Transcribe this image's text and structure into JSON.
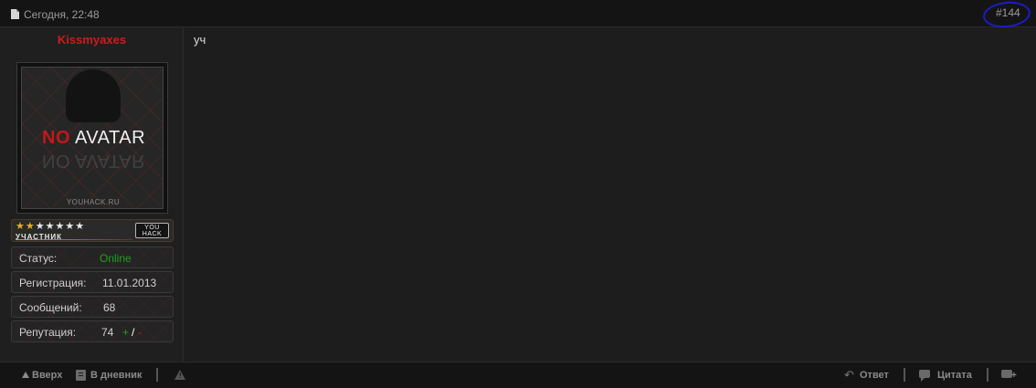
{
  "header": {
    "date": "Сегодня, 22:48",
    "post_number": "#144"
  },
  "user": {
    "name": "Kissmyaxes",
    "avatar": {
      "text_no": "NO",
      "text_avatar": "AVATAR",
      "site": "YOUHACK.RU"
    },
    "rank": {
      "title": "УЧАСТНИК",
      "stars_filled": 2,
      "stars_total": 7,
      "badge_line1": "YOU",
      "badge_line2": "HACK"
    },
    "info": {
      "status_label": "Статус:",
      "status_value": "Online",
      "reg_label": "Регистрация:",
      "reg_value": "11.01.2013",
      "posts_label": "Сообщений:",
      "posts_value": "68",
      "rep_label": "Репутация:",
      "rep_value": "74",
      "rep_plus": "+",
      "rep_slash": "/",
      "rep_minus": "-"
    }
  },
  "post": {
    "text": "уч"
  },
  "footer": {
    "up_label": "Вверх",
    "diary_label": "В дневник",
    "reply_label": "Ответ",
    "quote_label": "Цитата"
  },
  "colors": {
    "username": "#cc1d1d",
    "online": "#1ea01e",
    "highlight_circle": "#1c1cc8",
    "star_filled": "#e2b21e"
  }
}
